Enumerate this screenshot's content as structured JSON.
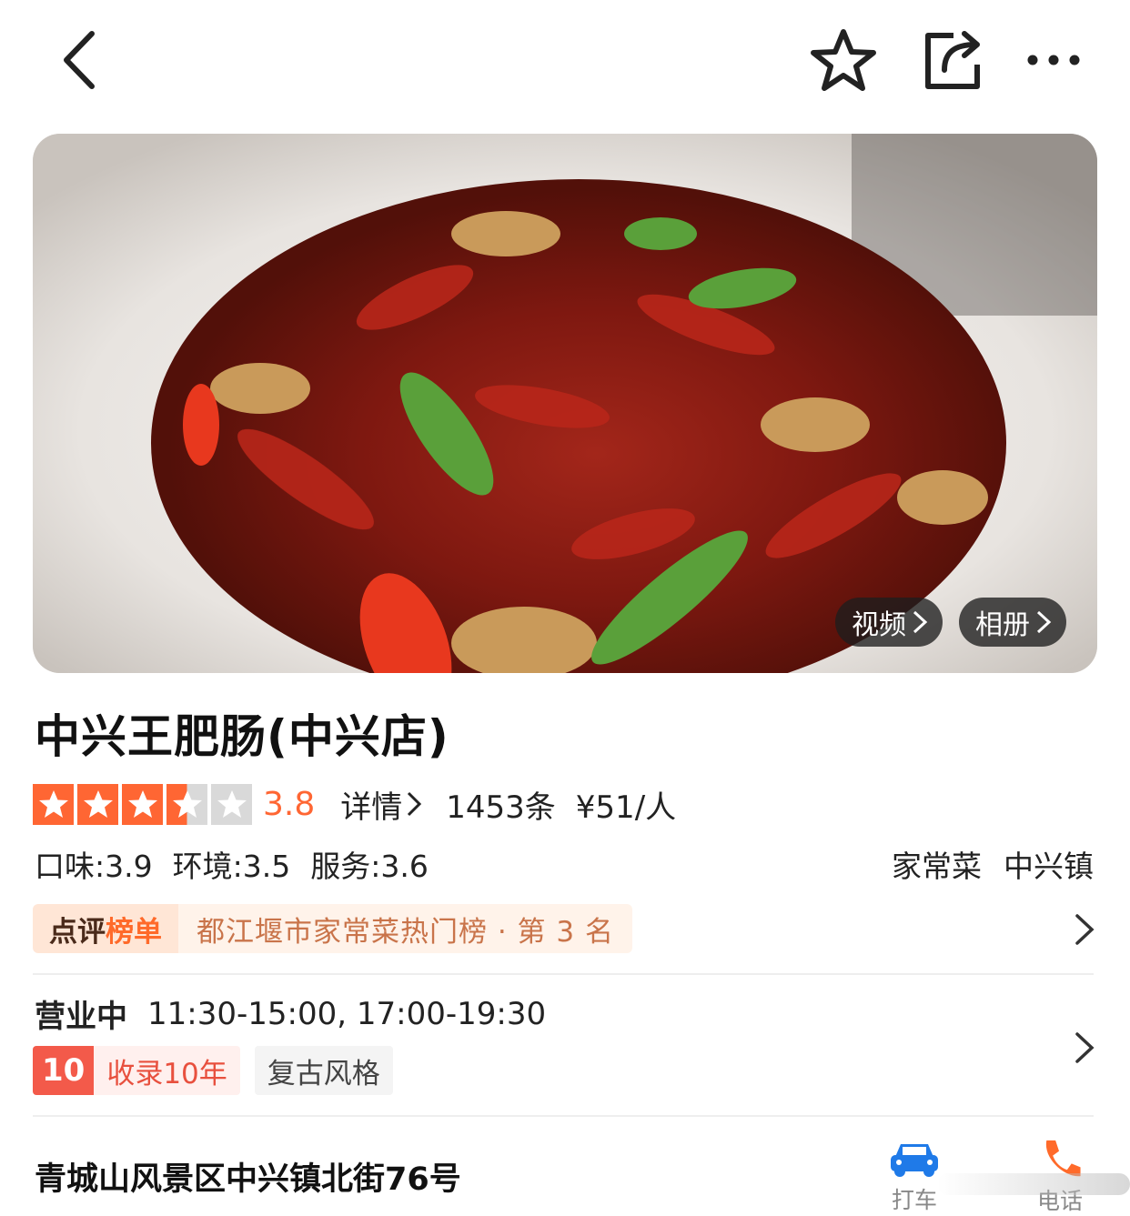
{
  "hero": {
    "video_label": "视频",
    "album_label": "相册"
  },
  "shop": {
    "name": "中兴王肥肠(中兴店)",
    "rating": {
      "stars_value": 3.5,
      "stars_max": 5,
      "score": "3.8",
      "detail_label": "详情",
      "review_count": "1453条",
      "price": "¥51/人"
    },
    "subscores": {
      "taste": "口味:3.9",
      "environment": "环境:3.5",
      "service": "服务:3.6"
    },
    "tags": {
      "cuisine": "家常菜",
      "area": "中兴镇"
    },
    "rank": {
      "badge_left": "点评",
      "badge_right": "榜单",
      "text": "都江堰市家常菜热门榜 · 第 3 名"
    },
    "hours": {
      "status": "营业中",
      "time": "11:30-15:00, 17:00-19:30"
    },
    "badges": {
      "years_num": "10",
      "years_text": "收录10年",
      "style": "复古风格"
    },
    "address": "青城山风景区中兴镇北街76号",
    "actions": {
      "taxi_label": "打车",
      "phone_label": "电话"
    }
  },
  "colors": {
    "accent": "#ff6633",
    "star_fill": "#ff6633",
    "star_empty": "#d9d9d9",
    "rank_text": "#c9744a",
    "year_badge": "#f35a4a",
    "taxi_icon": "#1f7ae8",
    "phone_icon": "#ff6a2a"
  },
  "icons": {
    "back": "chevron-left-icon",
    "favorite": "star-outline-icon",
    "share": "share-icon",
    "more": "ellipsis-icon",
    "taxi": "car-icon",
    "phone": "phone-icon"
  }
}
